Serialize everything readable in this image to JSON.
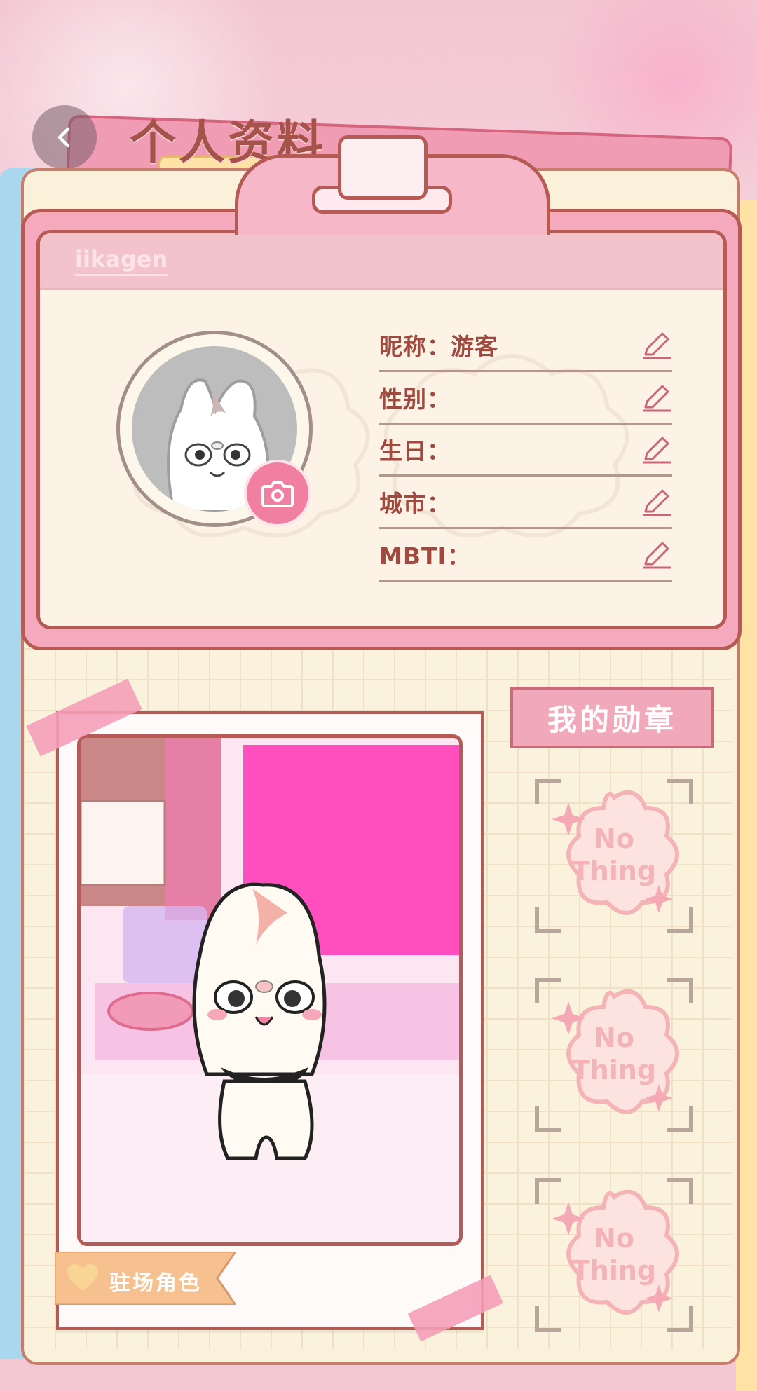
{
  "header": {
    "title": "个人资料",
    "back_icon": "chevron-left-icon"
  },
  "card": {
    "username": "iikagen",
    "fields": [
      {
        "label": "昵称：游客"
      },
      {
        "label": "性别："
      },
      {
        "label": "生日："
      },
      {
        "label": "城市："
      },
      {
        "label": "MBTI："
      }
    ]
  },
  "photo": {
    "tag_label": "驻场角色"
  },
  "medals": {
    "title": "我的勋章",
    "badges": [
      {
        "line1": "No",
        "line2": "Thing"
      },
      {
        "line1": "No",
        "line2": "Thing"
      },
      {
        "line1": "No",
        "line2": "Thing"
      }
    ]
  },
  "colors": {
    "accent_pink": "#f07fa2",
    "border_brown": "#b55a55",
    "text_brown": "#a0493f"
  }
}
